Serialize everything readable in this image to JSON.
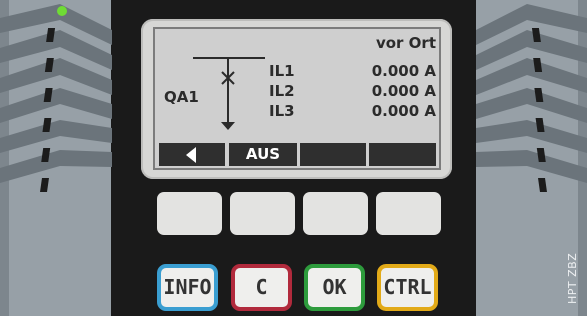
{
  "display": {
    "location": "vor Ort",
    "device_label": "QA1",
    "measurements": [
      {
        "name": "IL1",
        "value": "0.000 A"
      },
      {
        "name": "IL2",
        "value": "0.000 A"
      },
      {
        "name": "IL3",
        "value": "0.000 A"
      }
    ],
    "softkeys": {
      "key1_icon": "arrow-left-icon",
      "key2_label": "AUS",
      "key3_label": "",
      "key4_label": ""
    }
  },
  "keys": {
    "info": "INFO",
    "clear": "C",
    "ok": "OK",
    "ctrl": "CTRL"
  },
  "watermark": "HPT ZBZ",
  "colors": {
    "info_border": "#3a9ed1",
    "clear_border": "#b12a3c",
    "ok_border": "#2d9b3c",
    "ctrl_border": "#e2aa18",
    "led": "#6fdc35"
  }
}
